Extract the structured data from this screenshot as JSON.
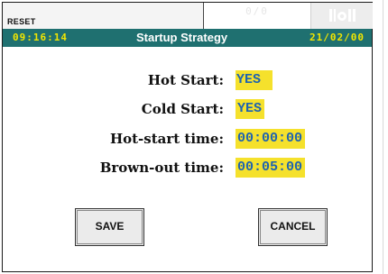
{
  "topbar": {
    "reset_label": "RESET",
    "counter": "0/0",
    "status_icon": "signal-bars-icon"
  },
  "header": {
    "time": "09:16:14",
    "title": "Startup Strategy",
    "date": "21/02/00",
    "background_color": "#1f7070",
    "accent_color": "#f2e600"
  },
  "fields": [
    {
      "label": "Hot Start:",
      "value": "YES"
    },
    {
      "label": "Cold Start:",
      "value": "YES"
    },
    {
      "label": "Hot-start time:",
      "value": "00:00:00"
    },
    {
      "label": "Brown-out time:",
      "value": "00:05:00"
    }
  ],
  "buttons": {
    "save_label": "SAVE",
    "cancel_label": "CANCEL"
  },
  "colors": {
    "value_highlight": "#f5e12c",
    "value_text": "#1e63b0"
  }
}
